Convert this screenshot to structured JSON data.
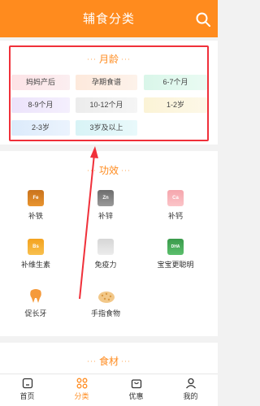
{
  "header": {
    "title": "辅食分类"
  },
  "age_section": {
    "title": "月龄",
    "title_dots": "···",
    "chips": [
      "妈妈产后",
      "孕期食谱",
      "6-7个月",
      "8-9个月",
      "10-12个月",
      "1-2岁",
      "2-3岁",
      "3岁及以上"
    ]
  },
  "func_section": {
    "title": "功效",
    "title_dots": "···",
    "items": [
      {
        "label": "补铁",
        "badge": "Fe",
        "icon": "fe-jar-icon"
      },
      {
        "label": "补锌",
        "badge": "Zn",
        "icon": "zn-jar-icon"
      },
      {
        "label": "补钙",
        "badge": "Ca",
        "icon": "ca-jar-icon"
      },
      {
        "label": "补维生素",
        "badge": "Bs",
        "icon": "vitamin-jar-icon"
      },
      {
        "label": "免疫力",
        "badge": "",
        "icon": "immunity-jar-icon"
      },
      {
        "label": "宝宝更聪明",
        "badge": "DHA",
        "icon": "dha-jar-icon"
      },
      {
        "label": "促长牙",
        "badge": "",
        "icon": "tooth-icon"
      },
      {
        "label": "手指食物",
        "badge": "",
        "icon": "finger-food-icon"
      }
    ]
  },
  "food_section": {
    "title": "食材",
    "title_dots": "···"
  },
  "tabbar": {
    "tabs": [
      {
        "label": "首页",
        "icon": "home-icon"
      },
      {
        "label": "分类",
        "icon": "category-icon"
      },
      {
        "label": "优惠",
        "icon": "bag-icon"
      },
      {
        "label": "我的",
        "icon": "user-icon"
      }
    ],
    "active_index": 1
  },
  "colors": {
    "accent": "#ff8b1e",
    "highlight": "#f0303a"
  }
}
